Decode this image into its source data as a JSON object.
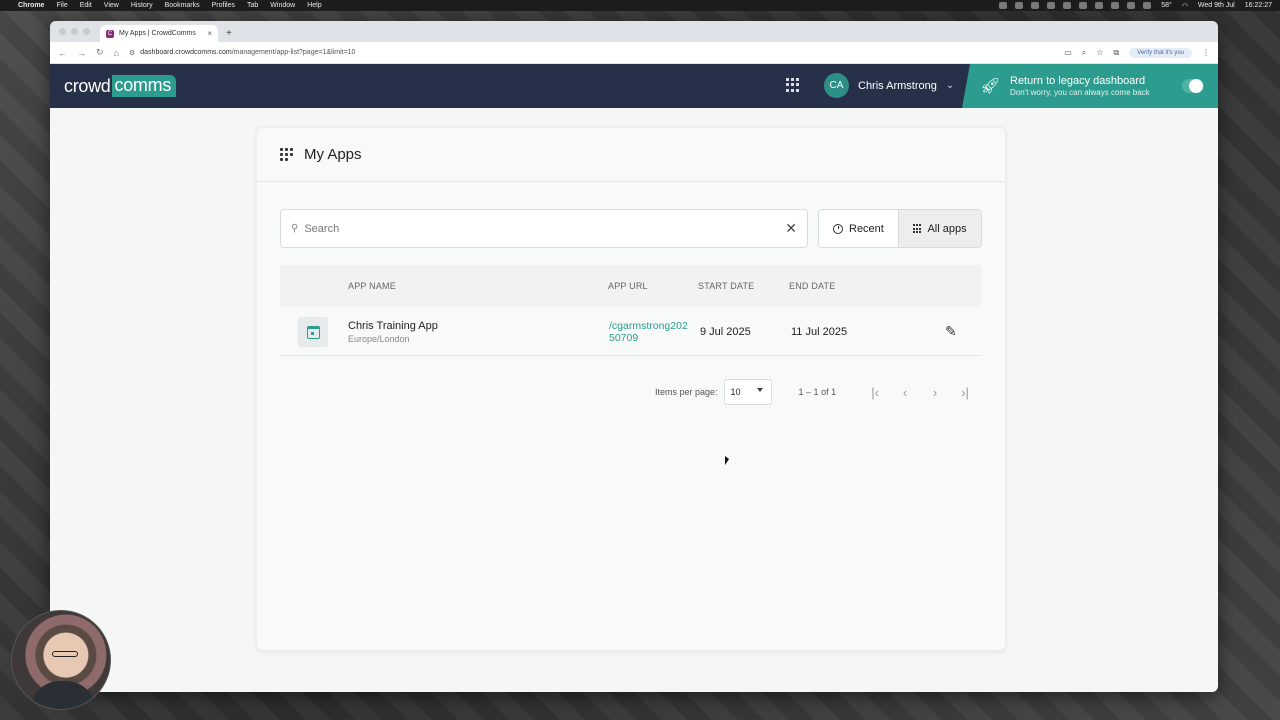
{
  "menubar": {
    "app": "Chrome",
    "items": [
      "File",
      "Edit",
      "View",
      "History",
      "Bookmarks",
      "Profiles",
      "Tab",
      "Window",
      "Help"
    ],
    "temp": "58°",
    "date": "Wed 9th Jul",
    "time": "16:22:27"
  },
  "browser": {
    "tab_title": "My Apps | CrowdComms",
    "url_domain": "dashboard.crowdcomms.com",
    "url_path": "/management/app-list?page=1&limit=10",
    "verify_label": "Verify that it's you"
  },
  "header": {
    "logo_a": "crowd",
    "logo_b": "comms",
    "avatar_initials": "CA",
    "user_name": "Chris Armstrong",
    "legacy_title": "Return to legacy dashboard",
    "legacy_sub": "Don't worry, you can always come back",
    "brand_color": "#2b9c8d",
    "header_color": "#273049"
  },
  "page": {
    "title": "My Apps",
    "search_placeholder": "Search",
    "recent_label": "Recent",
    "all_apps_label": "All apps"
  },
  "table": {
    "headers": {
      "name": "APP NAME",
      "url": "APP URL",
      "start": "START DATE",
      "end": "END DATE"
    },
    "rows": [
      {
        "name": "Chris Training App",
        "timezone": "Europe/London",
        "url": "/cgarmstrong20250709",
        "start": "9 Jul 2025",
        "end": "11 Jul 2025"
      }
    ]
  },
  "pager": {
    "items_per_page_label": "Items per page:",
    "items_per_page": "10",
    "range": "1 – 1 of 1"
  }
}
